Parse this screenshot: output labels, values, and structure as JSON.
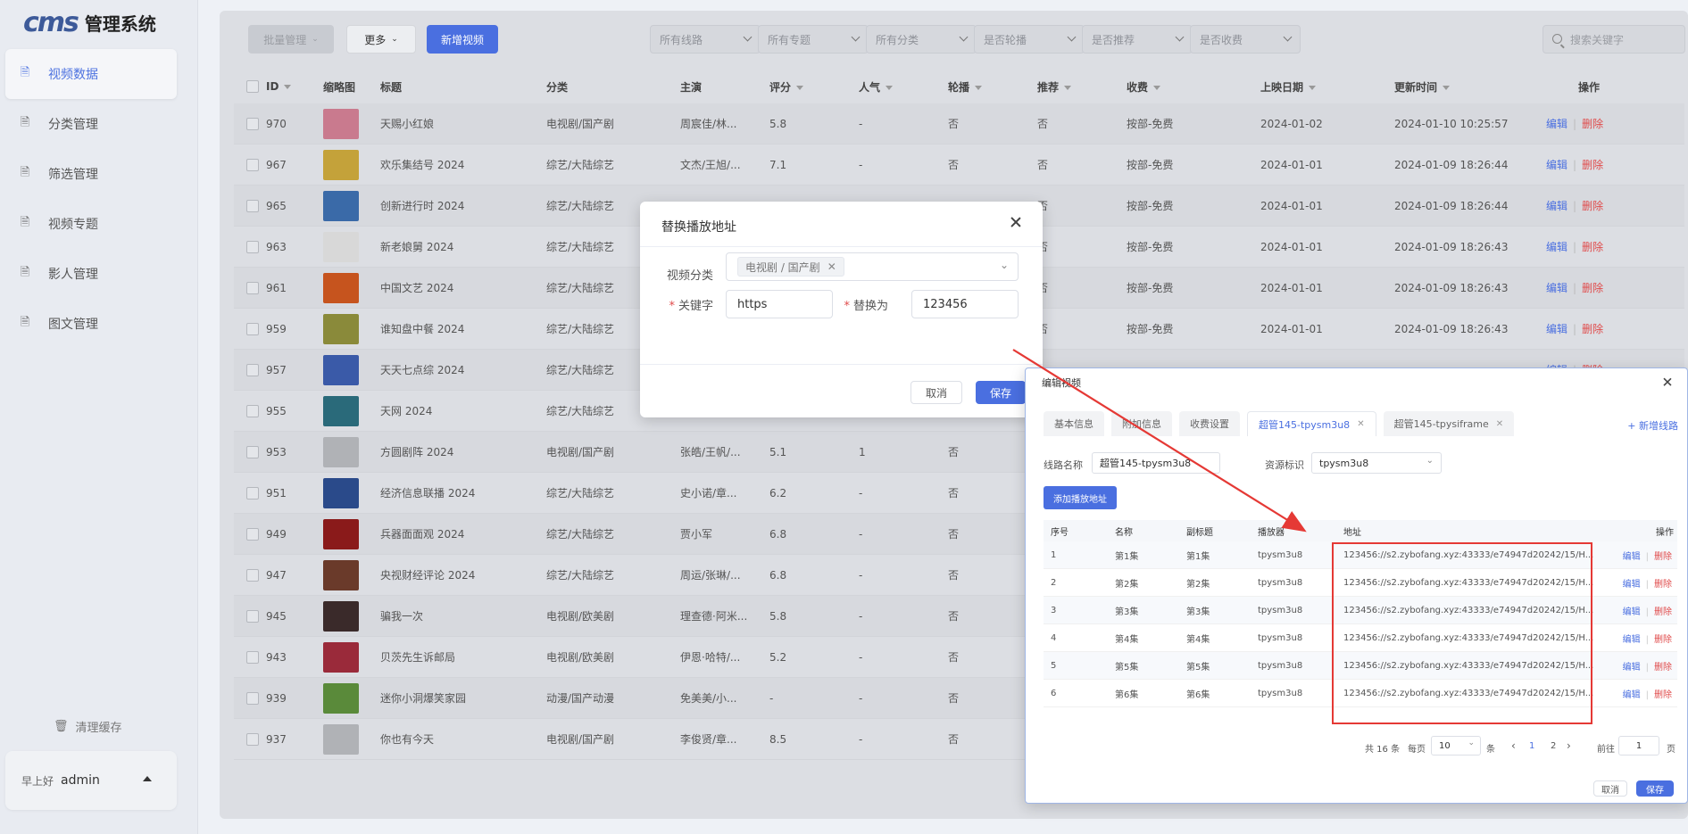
{
  "sidebar": {
    "logo_mark": "cms",
    "logo_text": "管理系统",
    "items": [
      {
        "label": "视频数据",
        "icon": "document-icon",
        "active": true
      },
      {
        "label": "分类管理",
        "icon": "document-icon",
        "active": false
      },
      {
        "label": "筛选管理",
        "icon": "document-icon",
        "active": false
      },
      {
        "label": "视频专题",
        "icon": "document-icon",
        "active": false
      },
      {
        "label": "影人管理",
        "icon": "document-icon",
        "active": false
      },
      {
        "label": "图文管理",
        "icon": "document-icon",
        "active": false
      }
    ],
    "clear_cache": "清理缓存",
    "greeting": "早上好",
    "username": "admin"
  },
  "toolbar": {
    "batch_label": "批量管理",
    "more_label": "更多",
    "add_label": "新增视频",
    "filters": [
      "所有线路",
      "所有专题",
      "所有分类",
      "是否轮播",
      "是否推荐",
      "是否收费"
    ],
    "search_placeholder": "搜索关键字"
  },
  "table": {
    "headers": {
      "id": "ID",
      "thumb": "缩略图",
      "title": "标题",
      "category": "分类",
      "host": "主演",
      "score": "评分",
      "popularity": "人气",
      "carousel": "轮播",
      "recommend": "推荐",
      "charge": "收费",
      "release": "上映日期",
      "updated": "更新时间",
      "ops": "操作"
    },
    "edit_label": "编辑",
    "delete_label": "删除",
    "rows": [
      {
        "id": "970",
        "title": "天赐小红娘",
        "category": "电视剧/国产剧",
        "host": "周宸佳/林...",
        "score": "5.8",
        "pop": "-",
        "carousel": "否",
        "recommend": "否",
        "charge": "按部-免费",
        "release": "2024-01-02",
        "updated": "2024-01-10 10:25:57",
        "thumb_color": "#c97a8e"
      },
      {
        "id": "967",
        "title": "欢乐集结号 2024",
        "category": "综艺/大陆综艺",
        "host": "文杰/王旭/...",
        "score": "7.1",
        "pop": "-",
        "carousel": "否",
        "recommend": "否",
        "charge": "按部-免费",
        "release": "2024-01-01",
        "updated": "2024-01-09 18:26:44",
        "thumb_color": "#c4a23a"
      },
      {
        "id": "965",
        "title": "创新进行时 2024",
        "category": "综艺/大陆综艺",
        "host": "",
        "score": "",
        "pop": "",
        "carousel": "",
        "recommend": "否",
        "charge": "按部-免费",
        "release": "2024-01-01",
        "updated": "2024-01-09 18:26:44",
        "thumb_color": "#3a6aa8"
      },
      {
        "id": "963",
        "title": "新老娘舅 2024",
        "category": "综艺/大陆综艺",
        "host": "",
        "score": "",
        "pop": "",
        "carousel": "",
        "recommend": "否",
        "charge": "按部-免费",
        "release": "2024-01-01",
        "updated": "2024-01-09 18:26:43",
        "thumb_color": "#d8d8d8"
      },
      {
        "id": "961",
        "title": "中国文艺 2024",
        "category": "综艺/大陆综艺",
        "host": "",
        "score": "",
        "pop": "",
        "carousel": "",
        "recommend": "否",
        "charge": "按部-免费",
        "release": "2024-01-01",
        "updated": "2024-01-09 18:26:43",
        "thumb_color": "#c6541e"
      },
      {
        "id": "959",
        "title": "谁知盘中餐 2024",
        "category": "综艺/大陆综艺",
        "host": "",
        "score": "",
        "pop": "",
        "carousel": "",
        "recommend": "否",
        "charge": "按部-免费",
        "release": "2024-01-01",
        "updated": "2024-01-09 18:26:43",
        "thumb_color": "#8a8a3a"
      },
      {
        "id": "957",
        "title": "天天七点综 2024",
        "category": "综艺/大陆综艺",
        "host": "",
        "score": "",
        "pop": "",
        "carousel": "",
        "recommend": "",
        "charge": "",
        "release": "",
        "updated": "",
        "thumb_color": "#3a5aa8"
      },
      {
        "id": "955",
        "title": "天网 2024",
        "category": "综艺/大陆综艺",
        "host": "",
        "score": "",
        "pop": "",
        "carousel": "",
        "recommend": "",
        "charge": "",
        "release": "",
        "updated": "",
        "thumb_color": "#2a6a7a"
      },
      {
        "id": "953",
        "title": "方圆剧阵 2024",
        "category": "电视剧/国产剧",
        "host": "张皓/王帆/...",
        "score": "5.1",
        "pop": "1",
        "carousel": "否",
        "recommend": "",
        "charge": "",
        "release": "",
        "updated": "",
        "thumb_color": "#b0b2b6"
      },
      {
        "id": "951",
        "title": "经济信息联播 2024",
        "category": "综艺/大陆综艺",
        "host": "史小诺/章...",
        "score": "6.2",
        "pop": "-",
        "carousel": "否",
        "recommend": "",
        "charge": "",
        "release": "",
        "updated": "",
        "thumb_color": "#2a4a8a"
      },
      {
        "id": "949",
        "title": "兵器面面观 2024",
        "category": "综艺/大陆综艺",
        "host": "贾小军",
        "score": "6.8",
        "pop": "-",
        "carousel": "否",
        "recommend": "",
        "charge": "",
        "release": "",
        "updated": "",
        "thumb_color": "#8a1a1a"
      },
      {
        "id": "947",
        "title": "央视财经评论 2024",
        "category": "综艺/大陆综艺",
        "host": "周运/张琳/...",
        "score": "6.8",
        "pop": "-",
        "carousel": "否",
        "recommend": "",
        "charge": "",
        "release": "",
        "updated": "",
        "thumb_color": "#6a3a2a"
      },
      {
        "id": "945",
        "title": "骗我一次",
        "category": "电视剧/欧美剧",
        "host": "理查德·阿米...",
        "score": "5.8",
        "pop": "-",
        "carousel": "否",
        "recommend": "",
        "charge": "",
        "release": "",
        "updated": "",
        "thumb_color": "#3a2a2a"
      },
      {
        "id": "943",
        "title": "贝茨先生诉邮局",
        "category": "电视剧/欧美剧",
        "host": "伊恩·哈特/...",
        "score": "5.2",
        "pop": "-",
        "carousel": "否",
        "recommend": "",
        "charge": "",
        "release": "",
        "updated": "",
        "thumb_color": "#9a2a3a"
      },
      {
        "id": "939",
        "title": "迷你小洞爆笑家园",
        "category": "动漫/国产动漫",
        "host": "免美美/小...",
        "score": "-",
        "pop": "-",
        "carousel": "否",
        "recommend": "",
        "charge": "",
        "release": "",
        "updated": "",
        "thumb_color": "#5a8a3a"
      },
      {
        "id": "937",
        "title": "你也有今天",
        "category": "电视剧/国产剧",
        "host": "李俊贤/章...",
        "score": "8.5",
        "pop": "-",
        "carousel": "否",
        "recommend": "",
        "charge": "",
        "release": "",
        "updated": "",
        "thumb_color": "#b0b2b6"
      }
    ]
  },
  "replace_modal": {
    "title": "替换播放地址",
    "category_label": "视频分类",
    "category_tag": "电视剧 / 国产剧",
    "keyword_label": "关键字",
    "keyword_value": "https",
    "replace_label": "替换为",
    "replace_value": "123456",
    "cancel_label": "取消",
    "save_label": "保存"
  },
  "edit_modal": {
    "title": "编辑视频",
    "tabs": [
      {
        "label": "基本信息",
        "active": false,
        "closable": false
      },
      {
        "label": "附加信息",
        "active": false,
        "closable": false
      },
      {
        "label": "收费设置",
        "active": false,
        "closable": false
      },
      {
        "label": "超管145-tpysm3u8",
        "active": true,
        "closable": true
      },
      {
        "label": "超管145-tpysiframe",
        "active": false,
        "closable": true
      }
    ],
    "add_line_label": "+ 新增线路",
    "line_name_label": "线路名称",
    "line_name_value": "超管145-tpysm3u8",
    "source_label": "资源标识",
    "source_value": "tpysm3u8",
    "add_play_label": "添加播放地址",
    "headers": {
      "no": "序号",
      "name": "名称",
      "sub": "副标题",
      "player": "播放器",
      "url": "地址",
      "ops": "操作"
    },
    "edit_label": "编辑",
    "delete_label": "删除",
    "rows": [
      {
        "no": "1",
        "name": "第1集",
        "sub": "第1集",
        "player": "tpysm3u8",
        "url": "123456://s2.zybofang.xyz:43333/e74947d20242/15/H..."
      },
      {
        "no": "2",
        "name": "第2集",
        "sub": "第2集",
        "player": "tpysm3u8",
        "url": "123456://s2.zybofang.xyz:43333/e74947d20242/15/H..."
      },
      {
        "no": "3",
        "name": "第3集",
        "sub": "第3集",
        "player": "tpysm3u8",
        "url": "123456://s2.zybofang.xyz:43333/e74947d20242/15/H..."
      },
      {
        "no": "4",
        "name": "第4集",
        "sub": "第4集",
        "player": "tpysm3u8",
        "url": "123456://s2.zybofang.xyz:43333/e74947d20242/15/H..."
      },
      {
        "no": "5",
        "name": "第5集",
        "sub": "第5集",
        "player": "tpysm3u8",
        "url": "123456://s2.zybofang.xyz:43333/e74947d20242/15/H..."
      },
      {
        "no": "6",
        "name": "第6集",
        "sub": "第6集",
        "player": "tpysm3u8",
        "url": "123456://s2.zybofang.xyz:43333/e74947d20242/15/H..."
      }
    ],
    "pager": {
      "total": "共 16 条",
      "per_page_label": "每页",
      "per_page": "10",
      "unit": "条",
      "page1": "1",
      "page2": "2",
      "goto_label": "前往",
      "goto_value": "1",
      "page_unit": "页"
    },
    "cancel_label": "取消",
    "save_label": "保存"
  },
  "colors": {
    "accent": "#4a6fe0",
    "danger": "#e04b4b",
    "annotation": "#e53935"
  }
}
